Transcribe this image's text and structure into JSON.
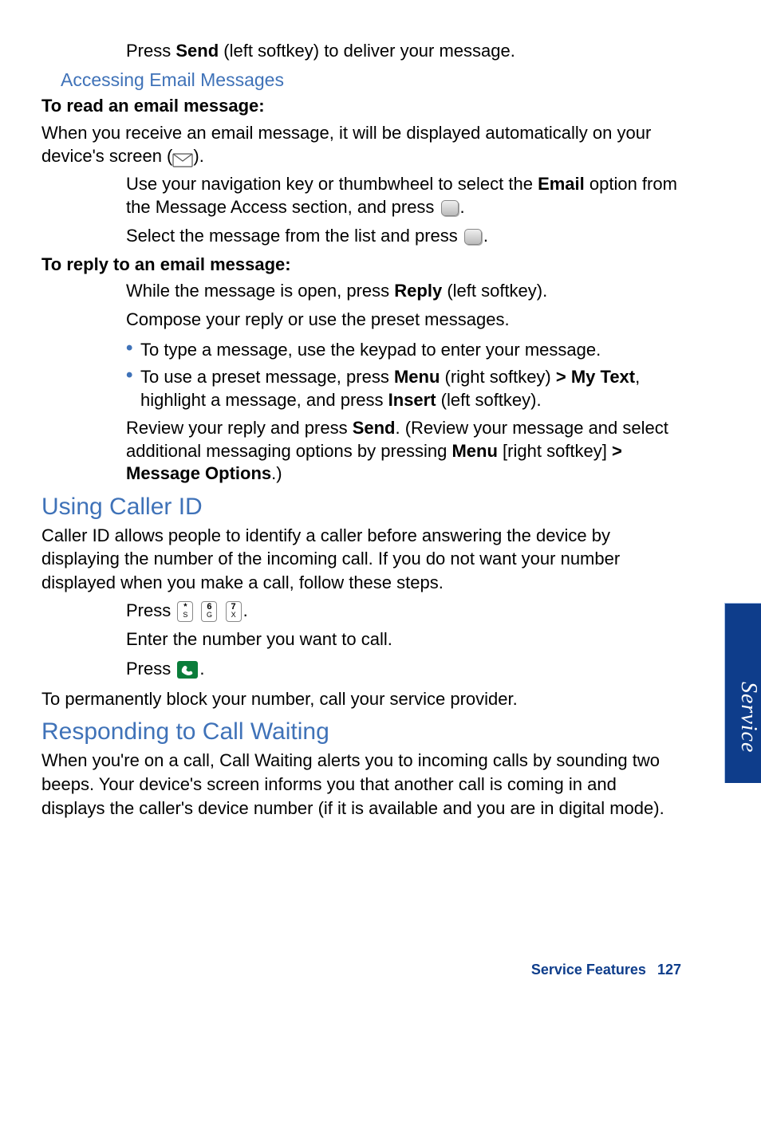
{
  "step_send": {
    "pre": "Press ",
    "bold": "Send",
    "post": " (left softkey) to deliver your message."
  },
  "sub_accessing": "Accessing Email Messages",
  "h_read": "To read an email message:",
  "read_intro_a": "When you receive an email message, it will be displayed automatically on your device's screen (",
  "read_intro_b": ").",
  "step_nav": {
    "a": "Use your navigation key or thumbwheel to select the ",
    "b": "Email",
    "c": " option from the Message Access section, and press "
  },
  "step_select": {
    "a": "Select the message from the list and press "
  },
  "h_reply": "To reply to an email message:",
  "step_reply1": {
    "a": "While the message is open, press ",
    "b": "Reply",
    "c": " (left softkey)."
  },
  "step_reply2": "Compose your reply or use the preset messages.",
  "bullet1": "To type a message, use the keypad to enter your message.",
  "bullet2": {
    "a": "To use a preset message, press ",
    "b": "Menu",
    "c": " (right softkey) ",
    "d": "> My Text",
    "e": ", highlight a message, and press ",
    "f": "Insert",
    "g": " (left softkey)."
  },
  "step_review": {
    "a": "Review your reply and press ",
    "b": "Send",
    "c": ". (Review your message and select additional messaging options by pressing ",
    "d": "Menu",
    "e": " [right softkey] ",
    "f": "> Message Options",
    "g": ".)"
  },
  "sec_caller": "Using Caller ID",
  "caller_body": "Caller ID allows people to identify a caller before answering the device by displaying the number of the incoming call. If you do not want your number displayed when you make a call, follow these steps.",
  "step_press_keys": "Press ",
  "step_enter_num": "Enter the number you want to call.",
  "step_press_green": "Press ",
  "caller_footer": "To permanently block your number, call your service provider.",
  "sec_wait": "Responding to Call Waiting",
  "wait_body": "When you're on a call, Call Waiting alerts you to incoming calls by sounding two beeps. Your device's screen informs you that another call is coming in and displays the caller's device number (if it is available and you are in digital mode).",
  "side_tab": "Service",
  "footer_label": "Service Features",
  "footer_page": "127",
  "keys": {
    "star_top": "*",
    "star_bot": "S",
    "six_top": "6",
    "six_bot": "G",
    "seven_top": "7",
    "seven_bot": "X"
  }
}
